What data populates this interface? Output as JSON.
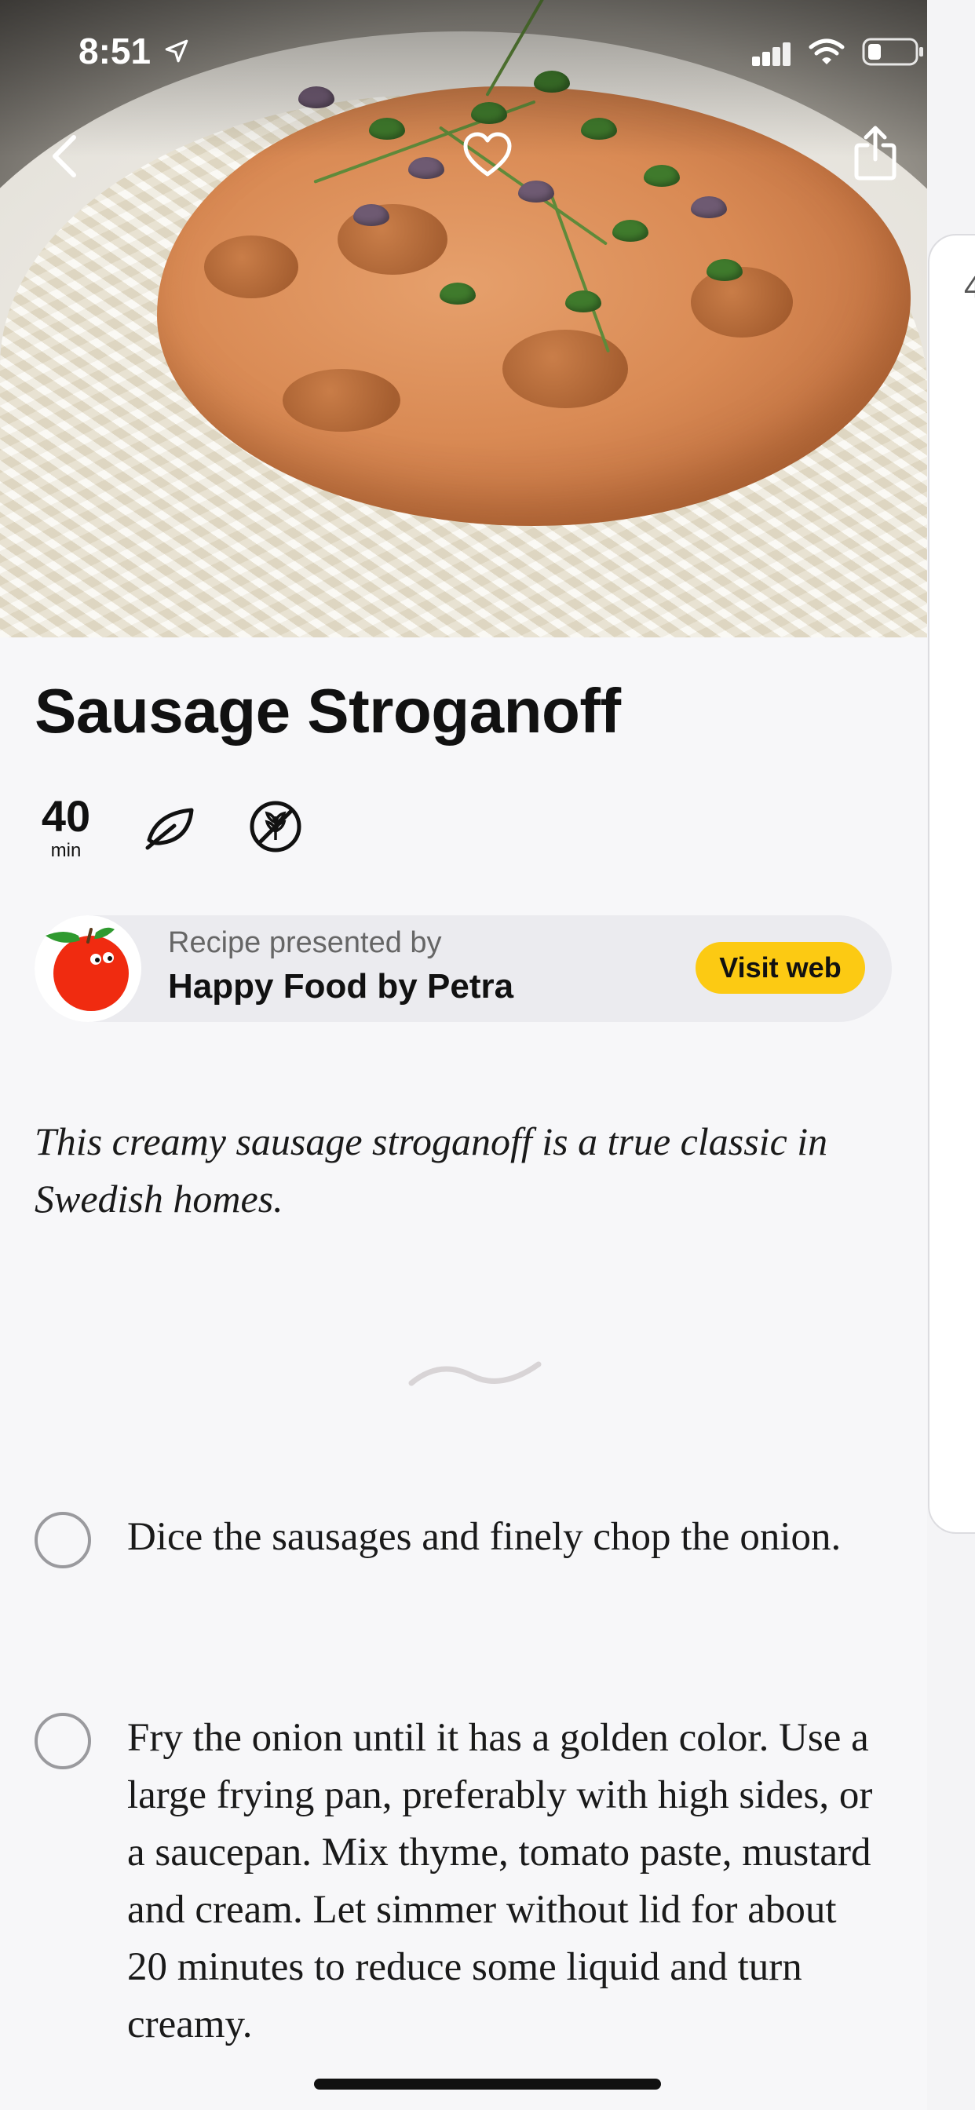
{
  "status_bar": {
    "time": "8:51"
  },
  "hero": {
    "icons": [
      "back-icon",
      "heart-icon",
      "share-icon"
    ]
  },
  "next_card": {
    "peek_text": "4"
  },
  "recipe": {
    "title": "Sausage Stroganoff",
    "time_value": "40",
    "time_unit": "min",
    "tags": [
      "leaf-icon",
      "no-gluten-icon"
    ],
    "presenter": {
      "label": "Recipe presented by",
      "name": "Happy Food by Petra",
      "button": "Visit web"
    },
    "intro": "This creamy sausage stroganoff is a true classic in Swedish homes.",
    "steps": [
      {
        "text": "Dice the sausages and finely chop the onion."
      },
      {
        "text": "Fry the onion until it has a golden color. Use a large frying pan, preferably with high sides, or a saucepan. Mix thyme, tomato paste, mustard and cream. Let simmer without lid for about 20 minutes to reduce some liquid and turn creamy."
      }
    ]
  },
  "colors": {
    "accent_button": "#fcca13",
    "background": "#f7f7f9",
    "presenter_bg": "#ebebef"
  }
}
